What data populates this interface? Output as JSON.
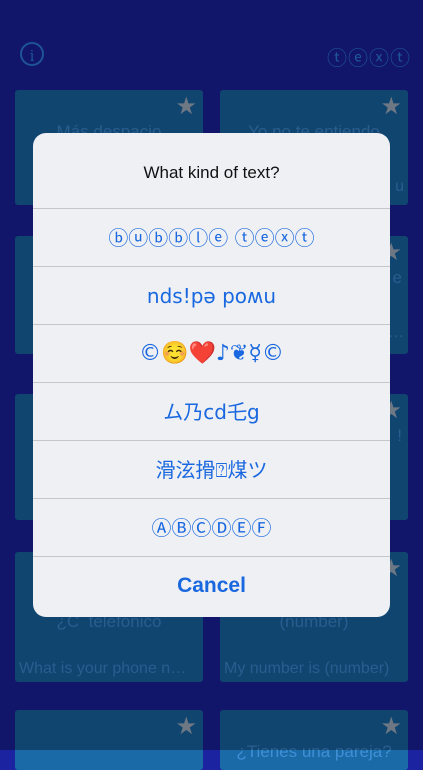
{
  "header": {
    "info_label": "i",
    "text_label": "ⓣⓔⓧⓣ"
  },
  "cards": [
    {
      "foreign": "Más despacio",
      "english": ""
    },
    {
      "foreign": "Yo no te entiendo",
      "english": "u"
    },
    {
      "foreign": "",
      "english": ""
    },
    {
      "foreign": "e",
      "english": "…"
    },
    {
      "foreign": "",
      "english": ""
    },
    {
      "foreign": "!",
      "english": ""
    },
    {
      "foreign": "¿C  telefónico",
      "english": "What is your phone n…"
    },
    {
      "foreign": "(number)",
      "english": "My number is (number)"
    },
    {
      "foreign": "",
      "english": ""
    },
    {
      "foreign": "¿Tienes una pareja?",
      "english": ""
    }
  ],
  "card_star": "★",
  "dialog": {
    "title": "What kind of text?",
    "options": [
      "ⓑⓤⓑⓑⓛⓔ ⓣⓔⓧⓣ",
      "nds!pǝ poʍu",
      "©☺️❤️♪❦☿©",
      "ム乃cd乇g",
      "滑泫搰⍰煤ツ",
      "ⒶⒷⒸⒹⒺⒻ"
    ],
    "cancel": "Cancel"
  },
  "colors": {
    "background": "#1b23a0",
    "card": "#1a6aa8",
    "accent": "#1a68e0"
  }
}
